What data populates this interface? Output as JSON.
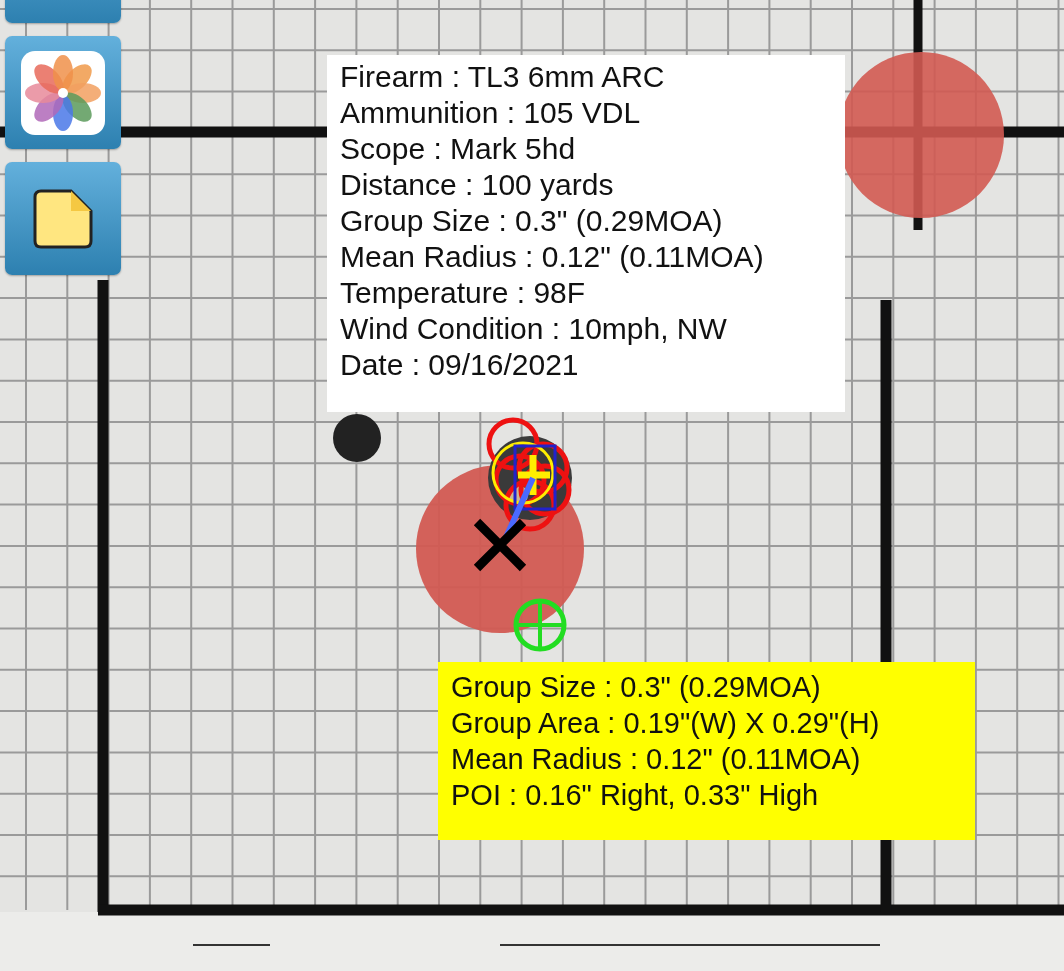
{
  "info_panel": {
    "lines": [
      "Firearm : TL3 6mm ARC",
      "Ammunition : 105 VDL",
      "Scope : Mark 5hd",
      "Distance : 100 yards",
      "Group Size : 0.3\" (0.29MOA)",
      "Mean Radius : 0.12\" (0.11MOA)",
      "Temperature : 98F",
      "Wind Condition : 10mph, NW",
      "Date : 09/16/2021"
    ]
  },
  "analysis_panel": {
    "lines": [
      "Group Size : 0.3\" (0.29MOA)",
      "Group Area : 0.19\"(W) X 0.29\"(H)",
      "Mean Radius : 0.12\" (0.11MOA)",
      "POI : 0.16\" Right,  0.33\" High"
    ]
  }
}
